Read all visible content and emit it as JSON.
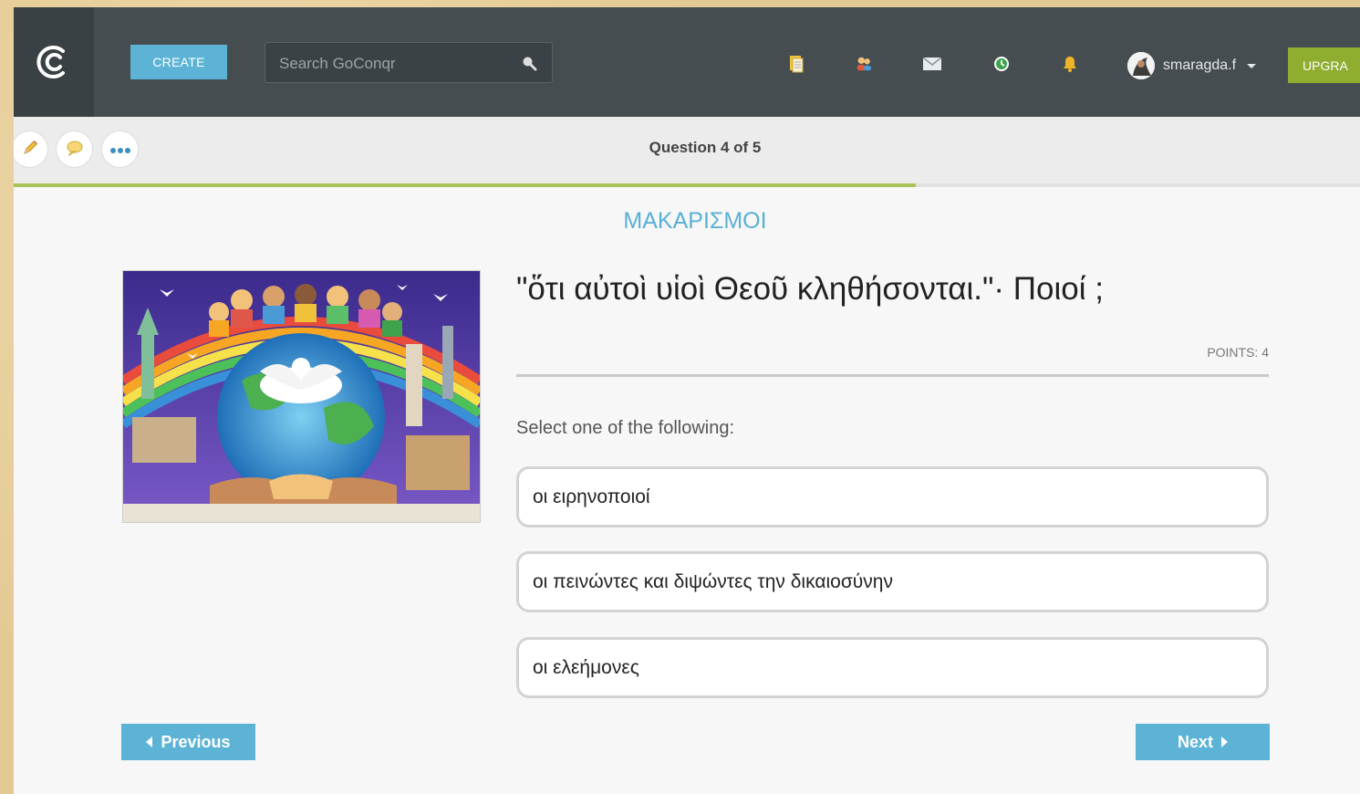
{
  "header": {
    "logo_icon": "goconqr-logo-icon",
    "create_label": "CREATE",
    "search_placeholder": "Search GoConqr",
    "icons": [
      "resources-icon",
      "groups-icon",
      "messages-icon",
      "activity-icon",
      "notifications-icon"
    ],
    "username": "smaragda.f",
    "upgrade_label": "UPGRA"
  },
  "toolbar": {
    "tools": [
      "pencil-icon",
      "comment-icon",
      "more-icon"
    ],
    "question_counter": "Question 4 of 5",
    "progress": 0.67
  },
  "quiz": {
    "section_title": "ΜΑΚΑΡΙΣΜΟΙ",
    "question": "\"ὅτι αὐτοὶ υἱοὶ Θεοῦ κληθήσονται.\"· Ποιοί ;",
    "points": "POINTS: 4",
    "instruction": "Select one of the following:",
    "answers": [
      "οι ειρηνοποιοί",
      "οι πεινώντες και διψώντες την δικαιοσύνην",
      "οι ελεήμονες"
    ],
    "previous_label": "Previous",
    "next_label": "Next"
  },
  "colors": {
    "accent": "#5cb3d6",
    "upgrade": "#8fad2f",
    "topbar": "#454d51",
    "progress": "#a9c456"
  }
}
